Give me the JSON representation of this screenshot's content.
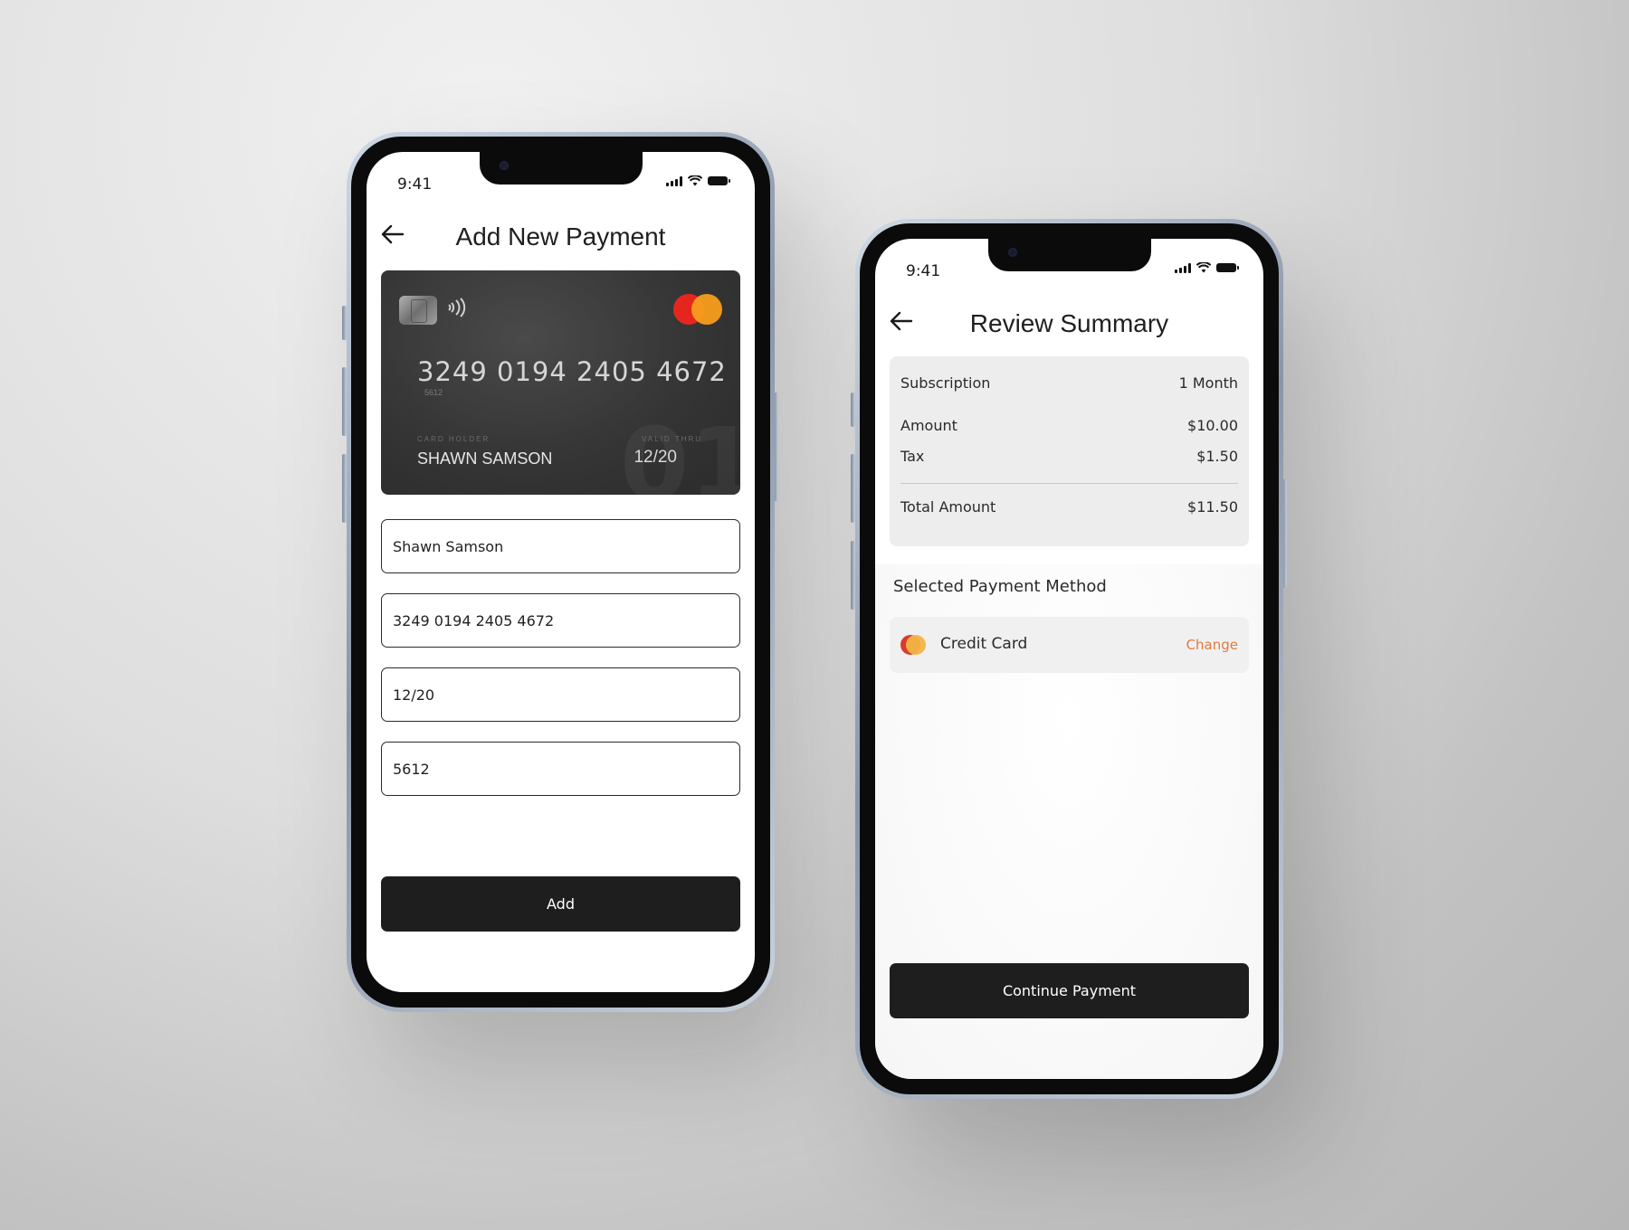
{
  "add_payment": {
    "status_time": "9:41",
    "title": "Add New Payment",
    "card": {
      "number": "3249 0194 2405 4672",
      "cvv": "5612",
      "holder_label": "CARD HOLDER",
      "holder": "SHAWN SAMSON",
      "valid_label": "VALID THRU",
      "expiry": "12/20"
    },
    "fields": {
      "name": "Shawn Samson",
      "number": "3249 0194 2405 4672",
      "expiry": "12/20",
      "cvv": "5612"
    },
    "add_label": "Add"
  },
  "review": {
    "status_time": "9:41",
    "title": "Review Summary",
    "summary": {
      "subscription_label": "Subscription",
      "subscription_value": "1 Month",
      "amount_label": "Amount",
      "amount_value": "$10.00",
      "tax_label": "Tax",
      "tax_value": "$1.50",
      "total_label": "Total Amount",
      "total_value": "$11.50"
    },
    "method_section_title": "Selected Payment Method",
    "method_label": "Credit Card",
    "change_label": "Change",
    "continue_label": "Continue Payment"
  },
  "icons": {
    "back": "arrow-left-icon",
    "chip": "card-chip-icon",
    "contactless": "contactless-icon",
    "brand": "mastercard-icon"
  },
  "colors": {
    "button_dark": "#1e1e1e",
    "change_link": "#e27a3f",
    "mastercard_red": "#e5261f",
    "mastercard_yellow": "#f79e1b"
  }
}
